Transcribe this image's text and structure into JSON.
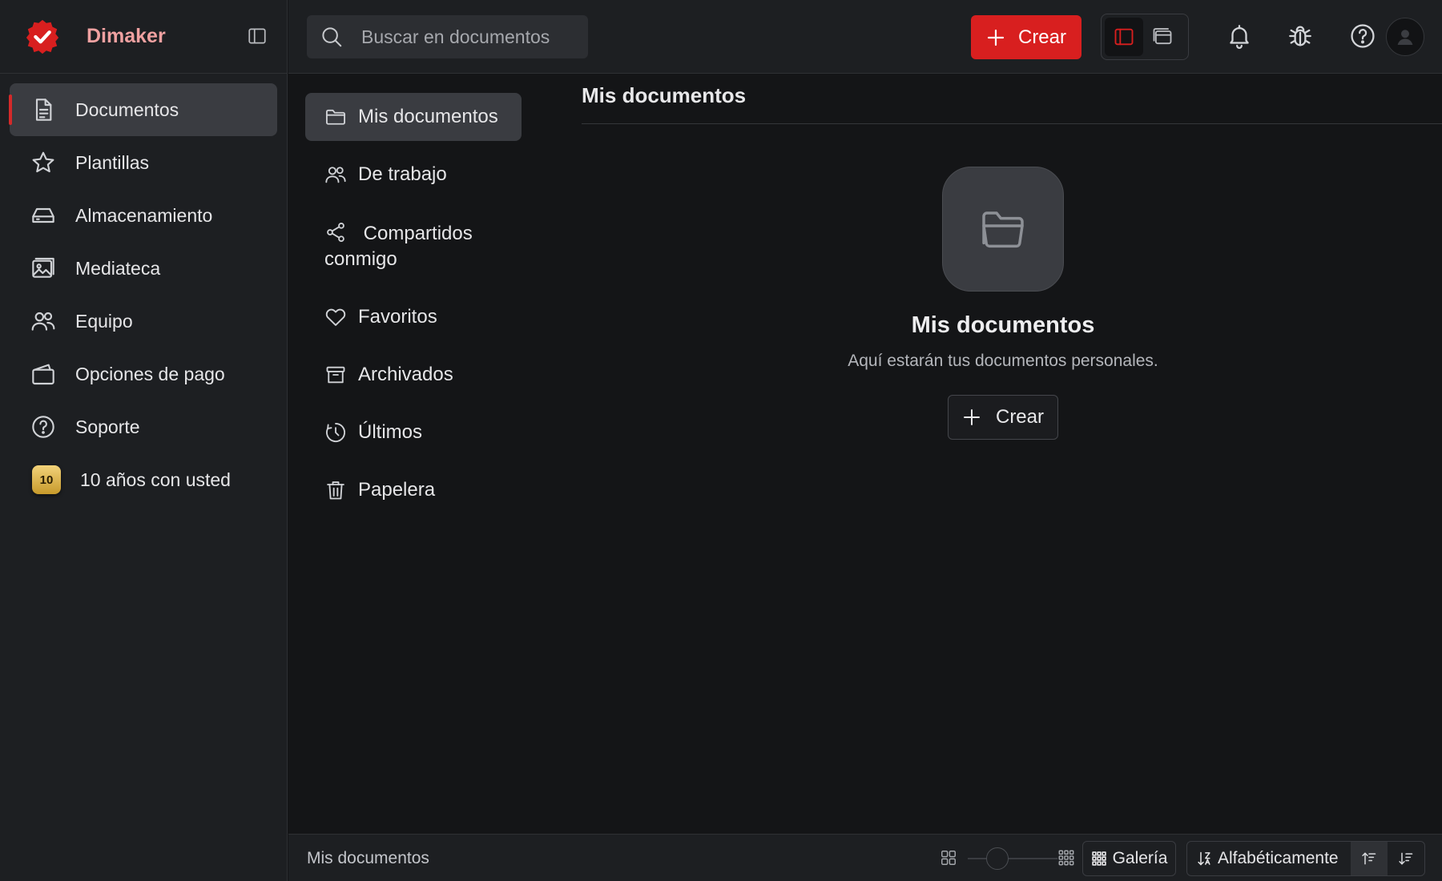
{
  "brand": {
    "name": "Dimaker",
    "accent": "#d81f1f"
  },
  "sidebar": {
    "items": [
      {
        "label": "Documentos",
        "icon": "document-icon",
        "active": true
      },
      {
        "label": "Plantillas",
        "icon": "star-icon"
      },
      {
        "label": "Almacenamiento",
        "icon": "storage-icon"
      },
      {
        "label": "Mediateca",
        "icon": "image-icon"
      },
      {
        "label": "Equipo",
        "icon": "team-icon"
      },
      {
        "label": "Opciones de pago",
        "icon": "wallet-icon"
      },
      {
        "label": "Soporte",
        "icon": "help-circle-icon"
      },
      {
        "label": "10 años con usted",
        "badge": "10"
      }
    ]
  },
  "topbar": {
    "search_placeholder": "Buscar en documentos",
    "create_label": "Crear"
  },
  "subnav": {
    "items": [
      {
        "label": "Mis documentos",
        "icon": "folder-icon",
        "active": true
      },
      {
        "label": "De trabajo",
        "icon": "team-icon"
      },
      {
        "label_line1": "Compartidos",
        "label_line2": "conmigo",
        "icon": "share-icon"
      },
      {
        "label": "Favoritos",
        "icon": "heart-icon"
      },
      {
        "label": "Archivados",
        "icon": "archive-icon"
      },
      {
        "label": "Últimos",
        "icon": "clock-icon"
      },
      {
        "label": "Papelera",
        "icon": "trash-icon"
      }
    ]
  },
  "main": {
    "title": "Mis documentos",
    "empty_state": {
      "title": "Mis documentos",
      "description": "Aquí estarán tus documentos personales.",
      "create_label": "Crear"
    }
  },
  "statusbar": {
    "path": "Mis documentos",
    "view_label": "Galería",
    "sort_label": "Alfabéticamente",
    "zoom_level": 0.33
  }
}
